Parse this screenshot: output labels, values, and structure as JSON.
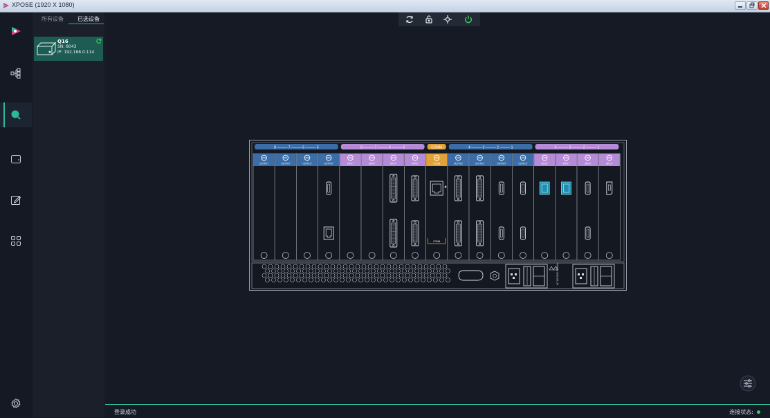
{
  "window": {
    "title": "XPOSE (1920 X 1080)",
    "controls": [
      "minimize-icon",
      "restore-icon",
      "close-icon"
    ]
  },
  "sidebar": {
    "items": [
      {
        "icon": "logo-icon"
      },
      {
        "icon": "topology-icon"
      },
      {
        "icon": "search-icon",
        "active": true
      },
      {
        "icon": "screen-icon"
      },
      {
        "icon": "edit-icon"
      },
      {
        "icon": "grid-icon"
      },
      {
        "icon": "settings-icon"
      }
    ]
  },
  "device_panel": {
    "tabs": [
      "所有设备",
      "已选设备"
    ],
    "active_tab": "已选设备",
    "device": {
      "name": "Q16",
      "sn": "SN: 8043",
      "ip": "IP: 192.168.0.114"
    }
  },
  "toolbar": {
    "buttons": [
      "refresh-icon",
      "unlock-icon",
      "locate-icon",
      "power-icon"
    ]
  },
  "chassis": {
    "groups": [
      {
        "label": "8 ——— 7 ——— 6 ——— 5",
        "kind": "output"
      },
      {
        "label": "8 ——— 7 ——— 6 ——— 5",
        "kind": "input"
      },
      {
        "label": "COMM",
        "kind": "comm"
      },
      {
        "label": "4 ——— 3 ——— 2 ——— 1",
        "kind": "output"
      },
      {
        "label": "4 ——— 3 ——— 2 ——— 1",
        "kind": "input"
      }
    ],
    "slots": [
      {
        "label": "OUTPUT",
        "kind": "output",
        "ports": []
      },
      {
        "label": "OUTPUT",
        "kind": "output",
        "ports": []
      },
      {
        "label": "OUTPUT",
        "kind": "output",
        "ports": []
      },
      {
        "label": "OUTPUT",
        "kind": "output",
        "ports": [
          "hdmi",
          "rj45"
        ]
      },
      {
        "label": "INPUT",
        "kind": "input",
        "ports": []
      },
      {
        "label": "INPUT",
        "kind": "input",
        "ports": []
      },
      {
        "label": "INPUT",
        "kind": "input",
        "ports": [
          "dvi-long",
          "dvi-long"
        ]
      },
      {
        "label": "INPUT",
        "kind": "input",
        "ports": [
          "dvi",
          "dvi"
        ]
      },
      {
        "label": "COMM",
        "kind": "comm",
        "ports": [
          "rj45-comm"
        ]
      },
      {
        "label": "OUTPUT",
        "kind": "output",
        "ports": [
          "dvi",
          "dvi"
        ]
      },
      {
        "label": "OUTPUT",
        "kind": "output",
        "ports": [
          "dvi",
          "dvi"
        ]
      },
      {
        "label": "OUTPUT",
        "kind": "output",
        "ports": [
          "hdmi",
          "hdmi"
        ]
      },
      {
        "label": "OUTPUT",
        "kind": "output",
        "ports": [
          "hdmi",
          "hdmi"
        ]
      },
      {
        "label": "INPUT",
        "kind": "input",
        "ports": [
          "sdi"
        ]
      },
      {
        "label": "INPUT",
        "kind": "input",
        "ports": [
          "sdi"
        ]
      },
      {
        "label": "INPUT",
        "kind": "input",
        "ports": [
          "hdmi",
          "hdmi"
        ]
      },
      {
        "label": "INPUT",
        "kind": "input",
        "ports": [
          "dp"
        ]
      }
    ],
    "comm_label": "COMM",
    "power_text": "AC 100-240V 50/60Hz"
  },
  "status": {
    "left": "登录成功",
    "right": "连接状态:",
    "connected": true
  },
  "colors": {
    "accent": "#2fb79b",
    "output": "#3b6ea8",
    "input": "#b58ad6",
    "comm": "#e2a23a"
  }
}
